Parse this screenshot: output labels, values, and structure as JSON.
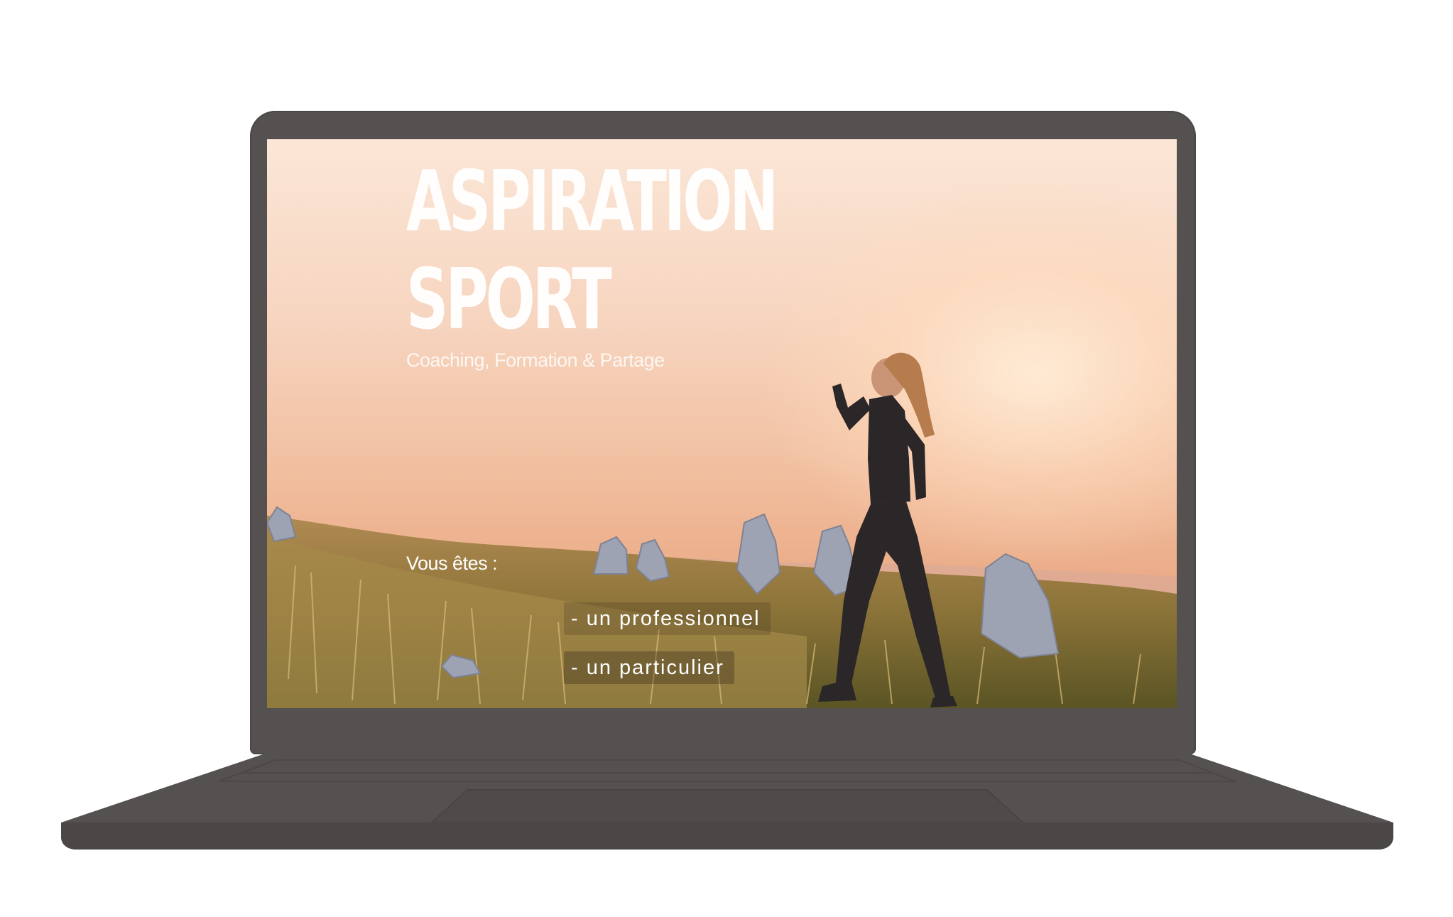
{
  "hero": {
    "title_line1": "ASPIRATION",
    "title_line2": "SPORT",
    "subtitle": "Coaching, Formation & Partage"
  },
  "audience": {
    "prompt": "Vous êtes :",
    "options": [
      {
        "label": "- un professionnel"
      },
      {
        "label": "- un particulier"
      }
    ]
  },
  "colors": {
    "device_body": "#545150",
    "text": "#ffffff"
  }
}
